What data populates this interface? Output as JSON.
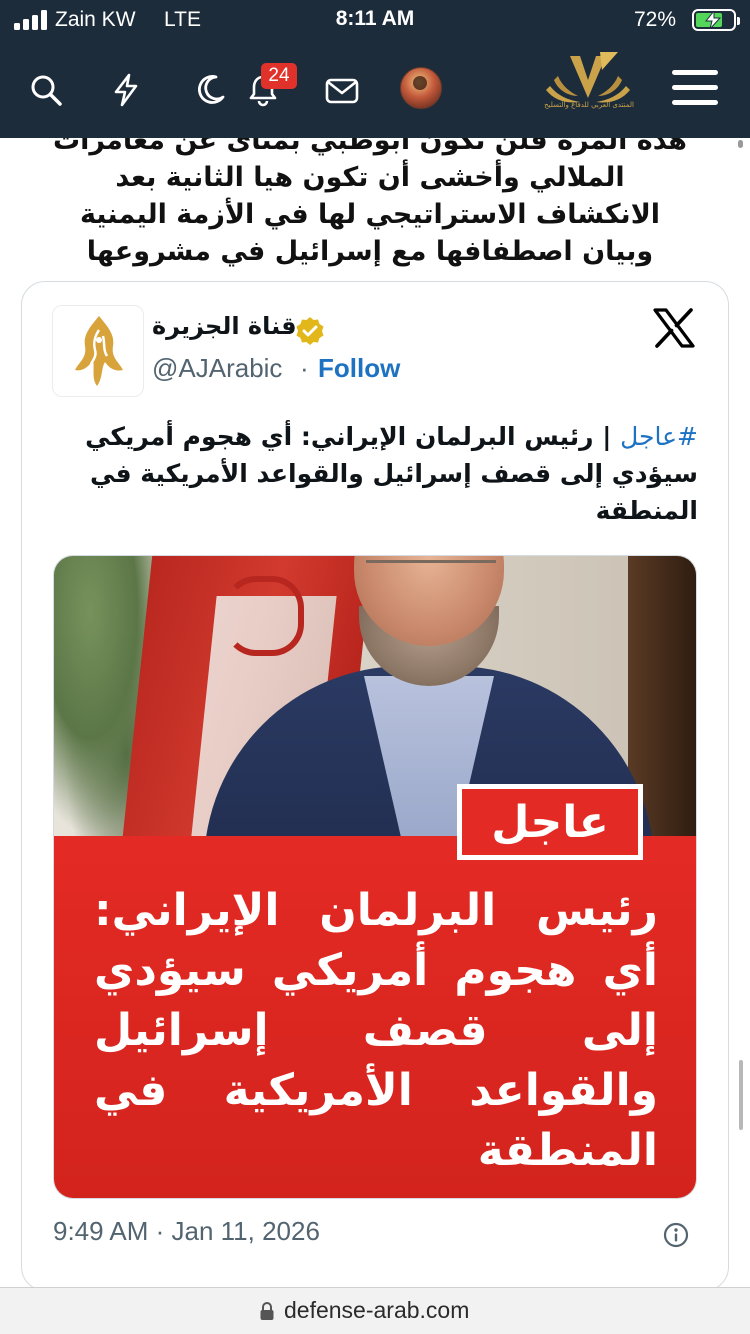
{
  "status_bar": {
    "carrier": "Zain KW",
    "network": "LTE",
    "time": "8:11 AM",
    "battery_percent": "72%",
    "battery_level": 0.72,
    "battery_color": "#54d65b"
  },
  "site_header": {
    "background": "#1d2c3b",
    "icons": [
      "search-icon",
      "lightning-icon",
      "moon-icon",
      "bell-icon",
      "mail-icon"
    ],
    "notification_count": "24",
    "logo_caption": "المنتدى العربي للدفاع والتسليح"
  },
  "article": {
    "lines": [
      "هذه المرة فلن تكون أبوظبي بمنأى عن مغامرات",
      "الملالي وأخشى أن تكون هيا الثانية بعد",
      "الانكشاف الاستراتيجي لها في الأزمة اليمنية",
      "وبيان اصطفافها مع إسرائيل في مشروعها"
    ]
  },
  "tweet": {
    "author_name": "قناة الجزيرة",
    "handle": "@AJArabic",
    "separator": "·",
    "follow_label": "Follow",
    "hashtag": "#عاجل",
    "body": " | رئيس البرلمان الإيراني: أي هجوم أمريكي سيؤدي إلى قصف إسرائيل والقواعد الأمريكية في المنطقة",
    "media": {
      "badge": "عاجل",
      "headline": "رئيس البرلمان الإيراني: أي هجوم أمريكي سيؤدي إلى قصف إسرائيل والقواعد الأمريكية في المنطقة"
    },
    "timestamp": "9:49 AM · Jan 11, 2026",
    "accent_color": "#1d72c2"
  },
  "url_bar": {
    "url": "defense-arab.com"
  }
}
